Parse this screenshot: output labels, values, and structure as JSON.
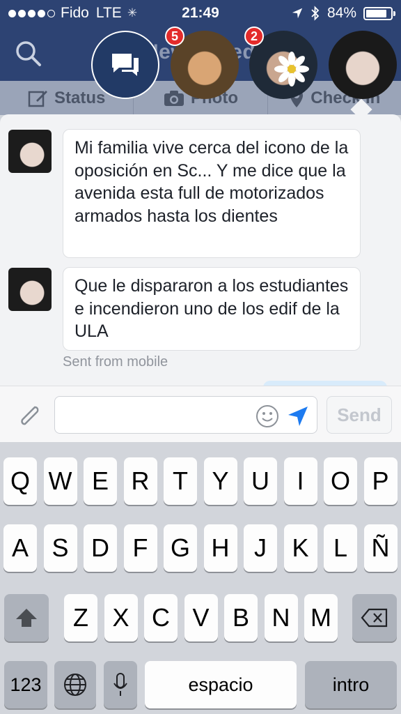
{
  "status_bar": {
    "carrier": "Fido",
    "network": "LTE",
    "time": "21:49",
    "battery": "84%",
    "battery_level": 0.84,
    "icons": [
      "signal-dots-icon",
      "activity-spinner-icon",
      "location-arrow-icon",
      "bluetooth-icon",
      "battery-icon"
    ]
  },
  "navbar": {
    "title": "News Feed",
    "search_icon": "search-icon"
  },
  "actions": [
    {
      "label": "Status",
      "icon": "edit-icon"
    },
    {
      "label": "Photo",
      "icon": "camera-icon"
    },
    {
      "label": "Check In",
      "icon": "map-pin-icon"
    }
  ],
  "chat_heads": {
    "messages_icon": "chat-bubbles-icon",
    "heads": [
      {
        "badge": "5",
        "colors": [
          "#5a4328",
          "#d9a574"
        ]
      },
      {
        "badge": "2",
        "colors": [
          "#1f2a38",
          "#c9a68f"
        ]
      },
      {
        "badge": "",
        "colors": [
          "#1a1a1a",
          "#e7d5cb"
        ]
      }
    ]
  },
  "messages": [
    {
      "text": "Mi familia vive cerca del icono de la oposición en Sc... Y me dice que la avenida esta full de motorizados armados hasta los dientes"
    },
    {
      "text": "Que le dispararon a los estudiantes e incendieron uno de los edif de la ULA"
    }
  ],
  "sent_note": "Sent from mobile",
  "composer": {
    "placeholder": "",
    "send_label": "Send",
    "icons": [
      "paperclip-icon",
      "smiley-icon",
      "location-arrow-icon"
    ]
  },
  "keyboard": {
    "row1": [
      "Q",
      "W",
      "E",
      "R",
      "T",
      "Y",
      "U",
      "I",
      "O",
      "P"
    ],
    "row2": [
      "A",
      "S",
      "D",
      "F",
      "G",
      "H",
      "J",
      "K",
      "L",
      "Ñ"
    ],
    "row3": [
      "Z",
      "X",
      "C",
      "V",
      "B",
      "N",
      "M"
    ],
    "numbers_label": "123",
    "space_label": "espacio",
    "return_label": "intro",
    "icons": [
      "shift-icon",
      "backspace-icon",
      "globe-icon",
      "microphone-icon"
    ]
  },
  "colors": {
    "facebook_blue": "#2d4373",
    "badge_red": "#e32b2b",
    "send_blue": "#1d7bf0"
  }
}
